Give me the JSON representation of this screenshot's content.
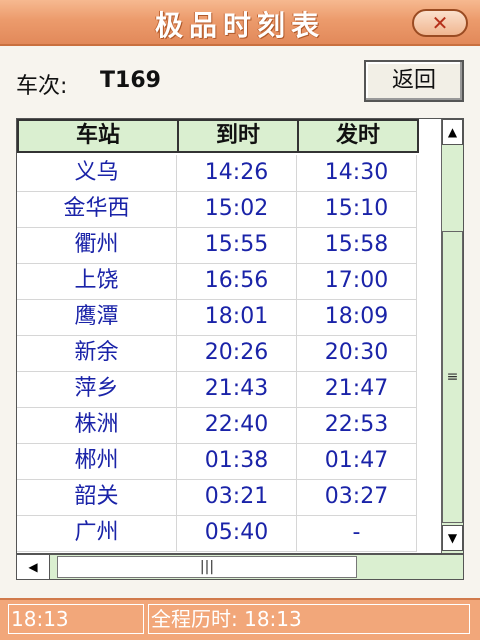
{
  "window": {
    "title": "极品时刻表",
    "close_label": "✕"
  },
  "header": {
    "train_label": "车次:",
    "train_number": "T169",
    "back_button": "返回"
  },
  "table": {
    "columns": [
      "车站",
      "到时",
      "发时"
    ],
    "rows": [
      [
        "义乌",
        "14:26",
        "14:30"
      ],
      [
        "金华西",
        "15:02",
        "15:10"
      ],
      [
        "衢州",
        "15:55",
        "15:58"
      ],
      [
        "上饶",
        "16:56",
        "17:00"
      ],
      [
        "鹰潭",
        "18:01",
        "18:09"
      ],
      [
        "新余",
        "20:26",
        "20:30"
      ],
      [
        "萍乡",
        "21:43",
        "21:47"
      ],
      [
        "株洲",
        "22:40",
        "22:53"
      ],
      [
        "郴州",
        "01:38",
        "01:47"
      ],
      [
        "韶关",
        "03:21",
        "03:27"
      ],
      [
        "广州",
        "05:40",
        "-"
      ]
    ]
  },
  "scrollbars": {
    "up_arrow": "▲",
    "down_arrow": "▼",
    "left_arrow": "◀",
    "grip_vertical": "≡",
    "grip_horizontal": "|||"
  },
  "status": {
    "time": "18:13",
    "total_duration": "全程历时: 18:13"
  },
  "colors": {
    "title_bar": "#ec9b6c",
    "header_fill": "#daefd0",
    "cell_text": "#1a23a8",
    "status_bar": "#f2a77a"
  }
}
